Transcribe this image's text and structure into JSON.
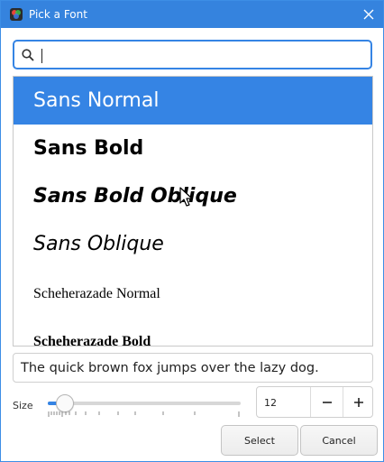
{
  "window": {
    "title": "Pick a Font",
    "app_icon": "font-viewer-icon",
    "close_icon": "close-icon"
  },
  "search": {
    "value": "",
    "placeholder": "",
    "icon": "search-icon"
  },
  "font_list": {
    "items": [
      {
        "label": "Sans Normal",
        "selected": true
      },
      {
        "label": "Sans Bold",
        "selected": false
      },
      {
        "label": "Sans Bold Oblique",
        "selected": false
      },
      {
        "label": "Sans Oblique",
        "selected": false
      },
      {
        "label": "Scheherazade Normal",
        "selected": false
      },
      {
        "label": "Scheherazade Bold",
        "selected": false
      }
    ]
  },
  "preview": {
    "text": "The quick brown fox jumps over the lazy dog."
  },
  "size": {
    "label": "Size",
    "value": "12",
    "slider_fraction": 0.09,
    "minus_label": "−",
    "plus_label": "+"
  },
  "buttons": {
    "select_label": "Select",
    "cancel_label": "Cancel"
  },
  "colors": {
    "accent": "#3584e4",
    "titlebar": "#3583de",
    "selected_text": "#ffffff"
  }
}
